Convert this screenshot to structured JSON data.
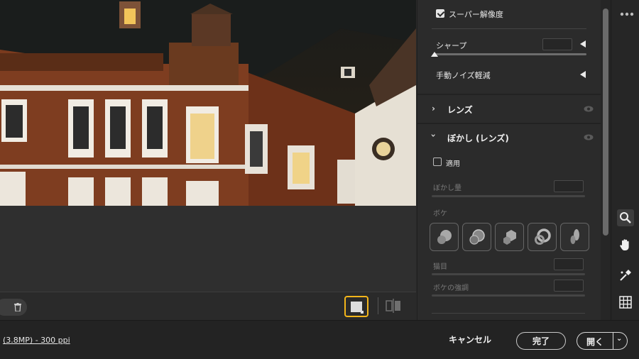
{
  "panel": {
    "super_resolution": {
      "label": "スーパー解像度",
      "checked": true
    },
    "sharpen": {
      "label": "シャープ"
    },
    "noise_reduction": {
      "label": "手動ノイズ軽減"
    },
    "lens_section": {
      "title": "レンズ",
      "expanded": false
    },
    "blur_section": {
      "title": "ぼかし (レンズ)",
      "expanded": true,
      "apply": {
        "label": "適用",
        "checked": false
      },
      "blur_amount": {
        "label": "ぼかし量"
      },
      "bokeh": {
        "label": "ボケ",
        "options": [
          "circle",
          "soap-bubble",
          "blade",
          "ring",
          "cat-eye"
        ]
      },
      "cat_eye": {
        "label": "猫目"
      },
      "boost": {
        "label": "ボケの強調"
      }
    }
  },
  "toolbar": {
    "tools": [
      "zoom-icon",
      "hand-icon",
      "color-sampler-icon",
      "grid-icon"
    ],
    "more": "more-icon"
  },
  "footer": {
    "image_info": "(3.8MP) - 300 ppi",
    "cancel_label": "キャンセル",
    "done_label": "完了",
    "open_label": "開く"
  },
  "colors": {
    "accent_view_button": "#f3b51a",
    "panel_bg": "#2b2b2b",
    "footer_bg": "#232323"
  }
}
